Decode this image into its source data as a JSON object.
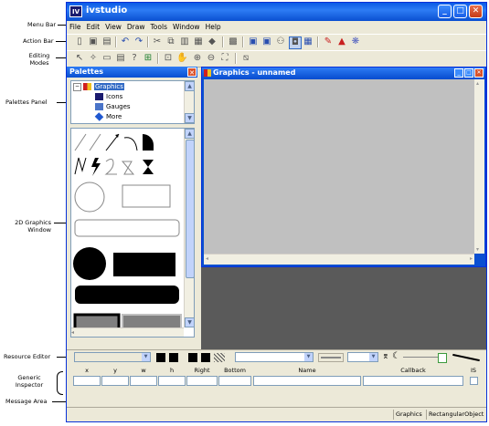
{
  "callouts": {
    "menu_bar": "Menu Bar",
    "action_bar": "Action Bar",
    "editing_modes_1": "Editing",
    "editing_modes_2": "Modes",
    "palettes_panel": "Palettes Panel",
    "graphics_window_1": "2D Graphics",
    "graphics_window_2": "Window",
    "resource_editor": "Resource Editor",
    "generic_inspector_1": "Generic",
    "generic_inspector_2": "Inspector",
    "message_area": "Message Area"
  },
  "app": {
    "title": "ivstudio",
    "icon_text": "IV"
  },
  "menu": {
    "items": [
      "File",
      "Edit",
      "View",
      "Draw",
      "Tools",
      "Window",
      "Help"
    ]
  },
  "palettes": {
    "title": "Palettes",
    "tree": [
      "Graphics",
      "Icons",
      "Gauges",
      "More"
    ]
  },
  "graphics": {
    "title": "Graphics - unnamed"
  },
  "inspector": {
    "headers": [
      "x",
      "y",
      "w",
      "h",
      "Right",
      "Bottom",
      "Name",
      "Callback",
      "IS"
    ]
  },
  "status": {
    "pane1": "Graphics",
    "pane2": "RectangularObject"
  },
  "colors": {
    "titlebar": "#0a4fd1",
    "window_bg": "#ece9d8",
    "canvas": "#c0c0c0",
    "workspace": "#5a5a5a"
  }
}
